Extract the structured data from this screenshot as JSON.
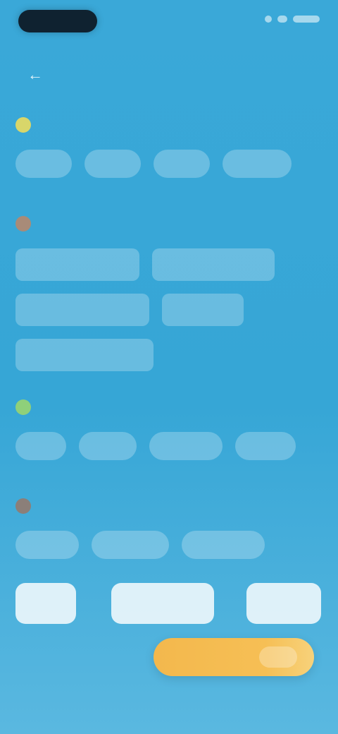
{
  "status_bar": {
    "time": ""
  },
  "header": {
    "title": "",
    "back_icon": "arrow-left-icon"
  },
  "sections": [
    {
      "title": "",
      "icon_color": "#d8d66a",
      "chips": [
        "",
        "",
        "",
        ""
      ]
    },
    {
      "title": "",
      "icon_color": "#a88b78",
      "chips": [
        "",
        "",
        "",
        "",
        ""
      ]
    },
    {
      "title": "",
      "icon_color": "#8fd07a",
      "chips": [
        "",
        "",
        "",
        ""
      ]
    },
    {
      "title": "",
      "icon_color": "#8b7f79",
      "chips": [
        "",
        "",
        ""
      ]
    }
  ],
  "actions": [
    "",
    "",
    ""
  ],
  "footer": {
    "link": "",
    "primary_button": ""
  },
  "colors": {
    "background": "#3aa8d8",
    "accent": "#f5bc51"
  }
}
